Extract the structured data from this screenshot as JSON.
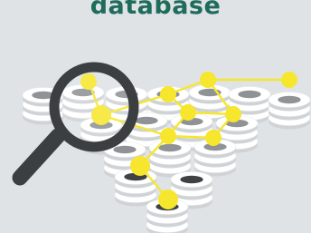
{
  "header": {
    "title": "database"
  },
  "illustration": {
    "icons": [
      "database-stack-icon",
      "magnifying-glass-icon",
      "network-node-icon"
    ]
  },
  "colors": {
    "background": "#dfe3e6",
    "title": "#1f6b5c",
    "accent": "#f6e62e",
    "lens": "#3c3f41",
    "disk_light": "#ffffff",
    "disk_dark": "#8f9396"
  }
}
